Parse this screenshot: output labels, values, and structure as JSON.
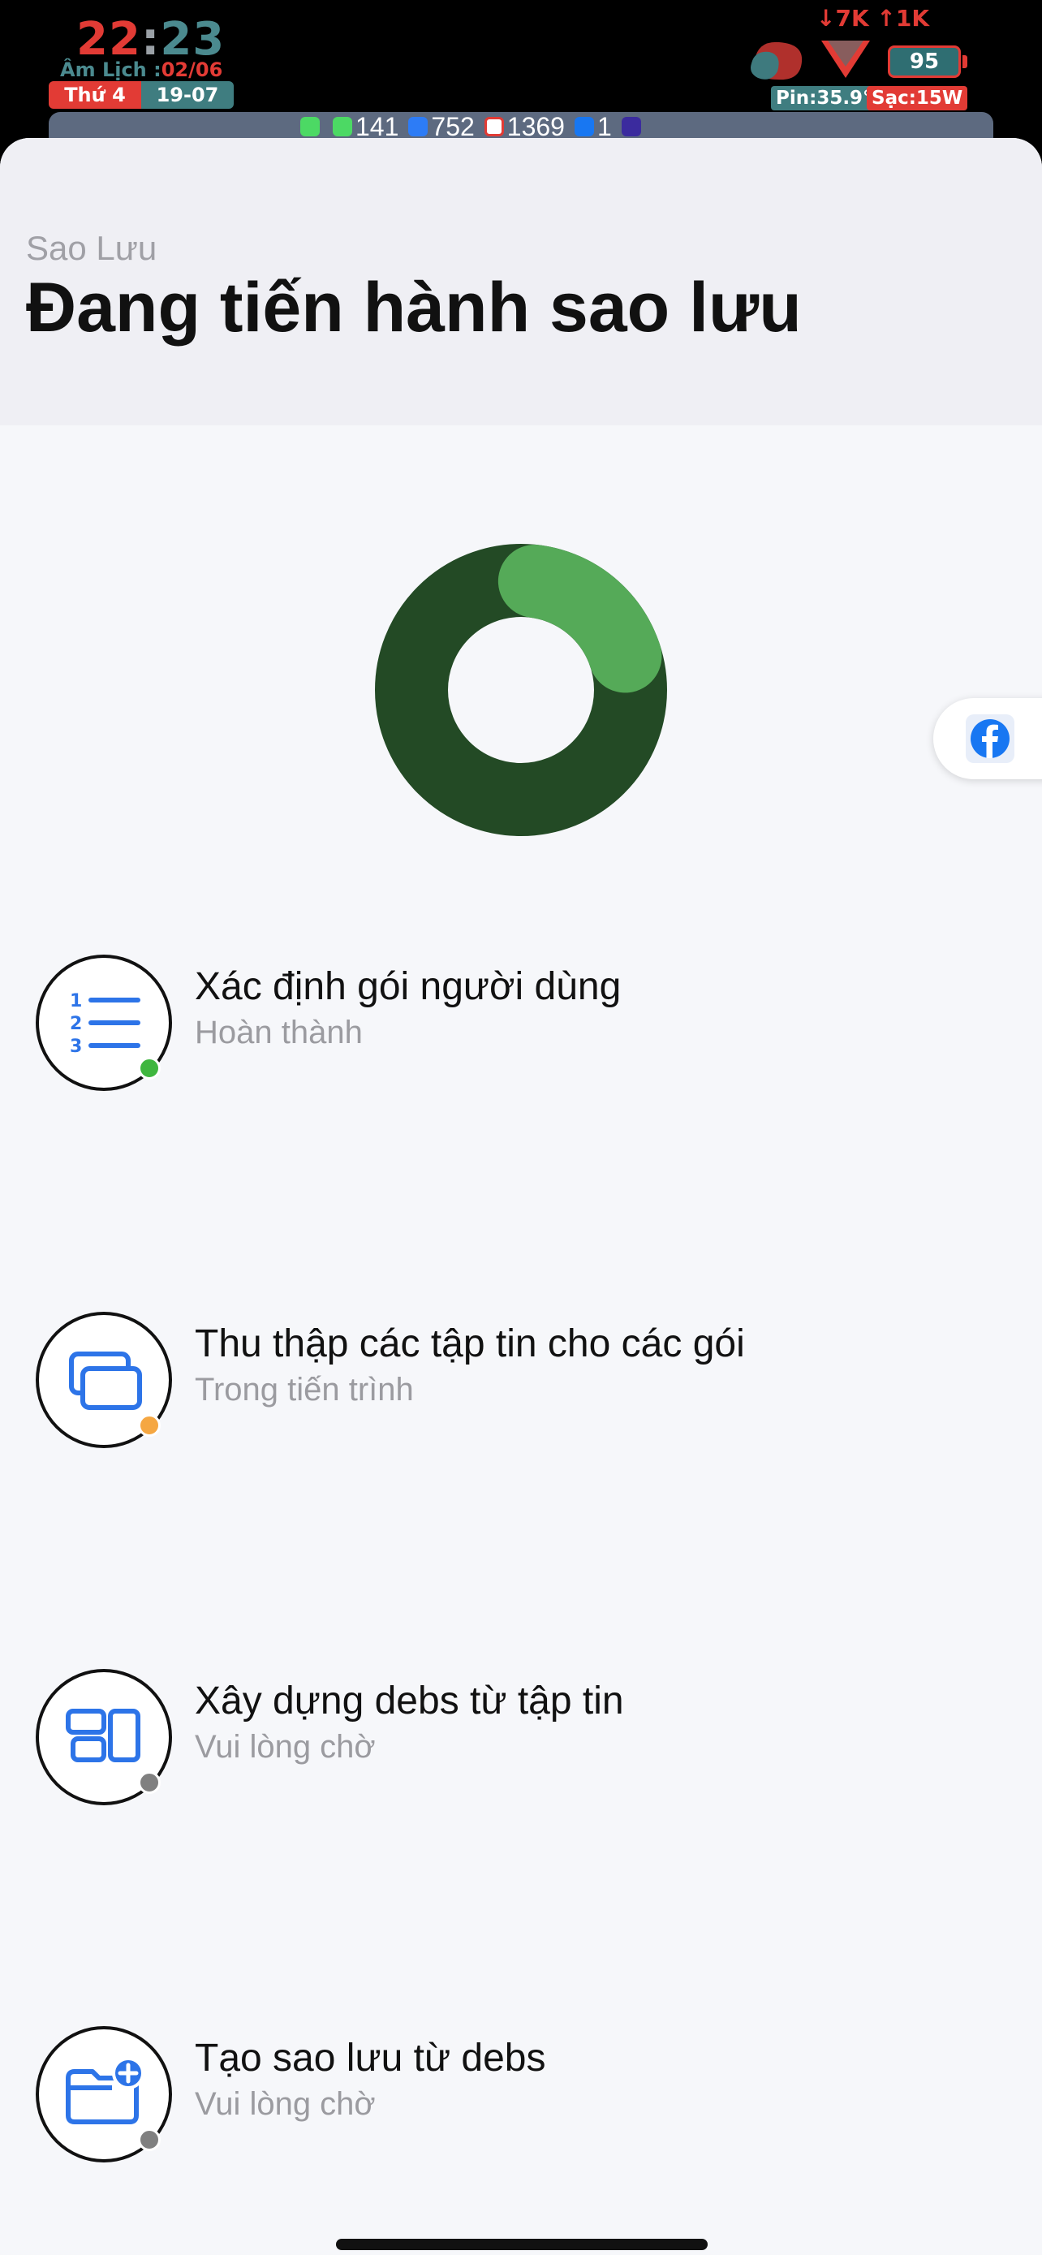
{
  "status_bar": {
    "time_hh": "22",
    "time_colon": ":",
    "time_mm": "23",
    "lunar_label": "Âm Lịch :",
    "lunar_date": "02/06",
    "weekday": "Thứ 4",
    "date": "19-07",
    "net_speed": "↓7K ↑1K",
    "battery": "95",
    "pin_temp": "Pin:35.9°",
    "charging": "Sạc:15W",
    "notifications": [
      {
        "app": "phone",
        "count": ""
      },
      {
        "app": "messages",
        "count": "141"
      },
      {
        "app": "zalo",
        "count": "752"
      },
      {
        "app": "gmail",
        "count": "1369"
      },
      {
        "app": "facebook",
        "count": "1"
      },
      {
        "app": "app",
        "count": ""
      }
    ]
  },
  "header": {
    "back_label": "Sao Lưu",
    "title": "Đang tiến hành sao lưu"
  },
  "progress": {
    "fraction": 0.18,
    "track_color": "#234a25",
    "fill_color": "#55aa58"
  },
  "steps": [
    {
      "title": "Xác định gói người dùng",
      "status": "Hoàn thành",
      "icon": "numbered-list-icon",
      "dot_color": "#3fb63f"
    },
    {
      "title": "Thu thập các tập tin cho các gói",
      "status": "Trong tiến trình",
      "icon": "stacked-cards-icon",
      "dot_color": "#f5a742"
    },
    {
      "title": "Xây dựng debs từ tập tin",
      "status": "Vui lòng chờ",
      "icon": "layout-blocks-icon",
      "dot_color": "#808080"
    },
    {
      "title": "Tạo sao lưu từ debs",
      "status": "Vui lòng chờ",
      "icon": "folder-add-icon",
      "dot_color": "#808080"
    }
  ]
}
